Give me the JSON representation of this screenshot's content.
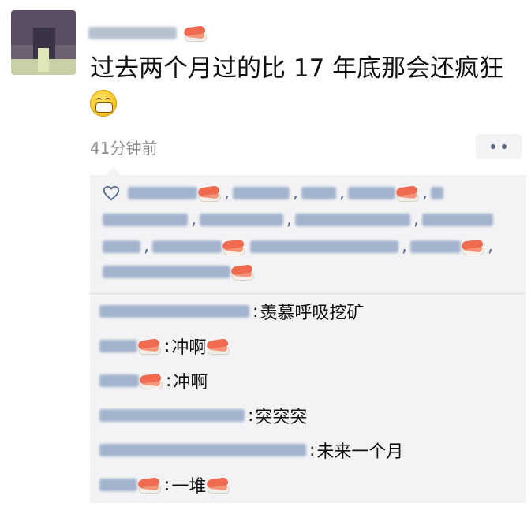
{
  "post": {
    "text": "过去两个月过的比 17 年底那会还疯狂",
    "time": "41分钟前",
    "emoji_after_text": "grinning-face-icon",
    "nickname_emoji": "sushi-icon"
  },
  "actions": {
    "more_icon": "more-dots-icon"
  },
  "likes": {
    "icon": "heart-icon",
    "separator": ","
  },
  "comments": [
    {
      "text": "羡慕呼吸挖矿",
      "colon": ":"
    },
    {
      "text": "冲啊",
      "colon": ":"
    },
    {
      "text": "冲啊",
      "colon": ":"
    },
    {
      "text": "突突突",
      "colon": ":"
    },
    {
      "text": "未来一个月",
      "colon": ":"
    },
    {
      "text": "一堆",
      "colon": ":"
    }
  ],
  "colors": {
    "link": "#576b95",
    "time": "#8d8d8d",
    "box_bg": "#f3f3f5"
  }
}
